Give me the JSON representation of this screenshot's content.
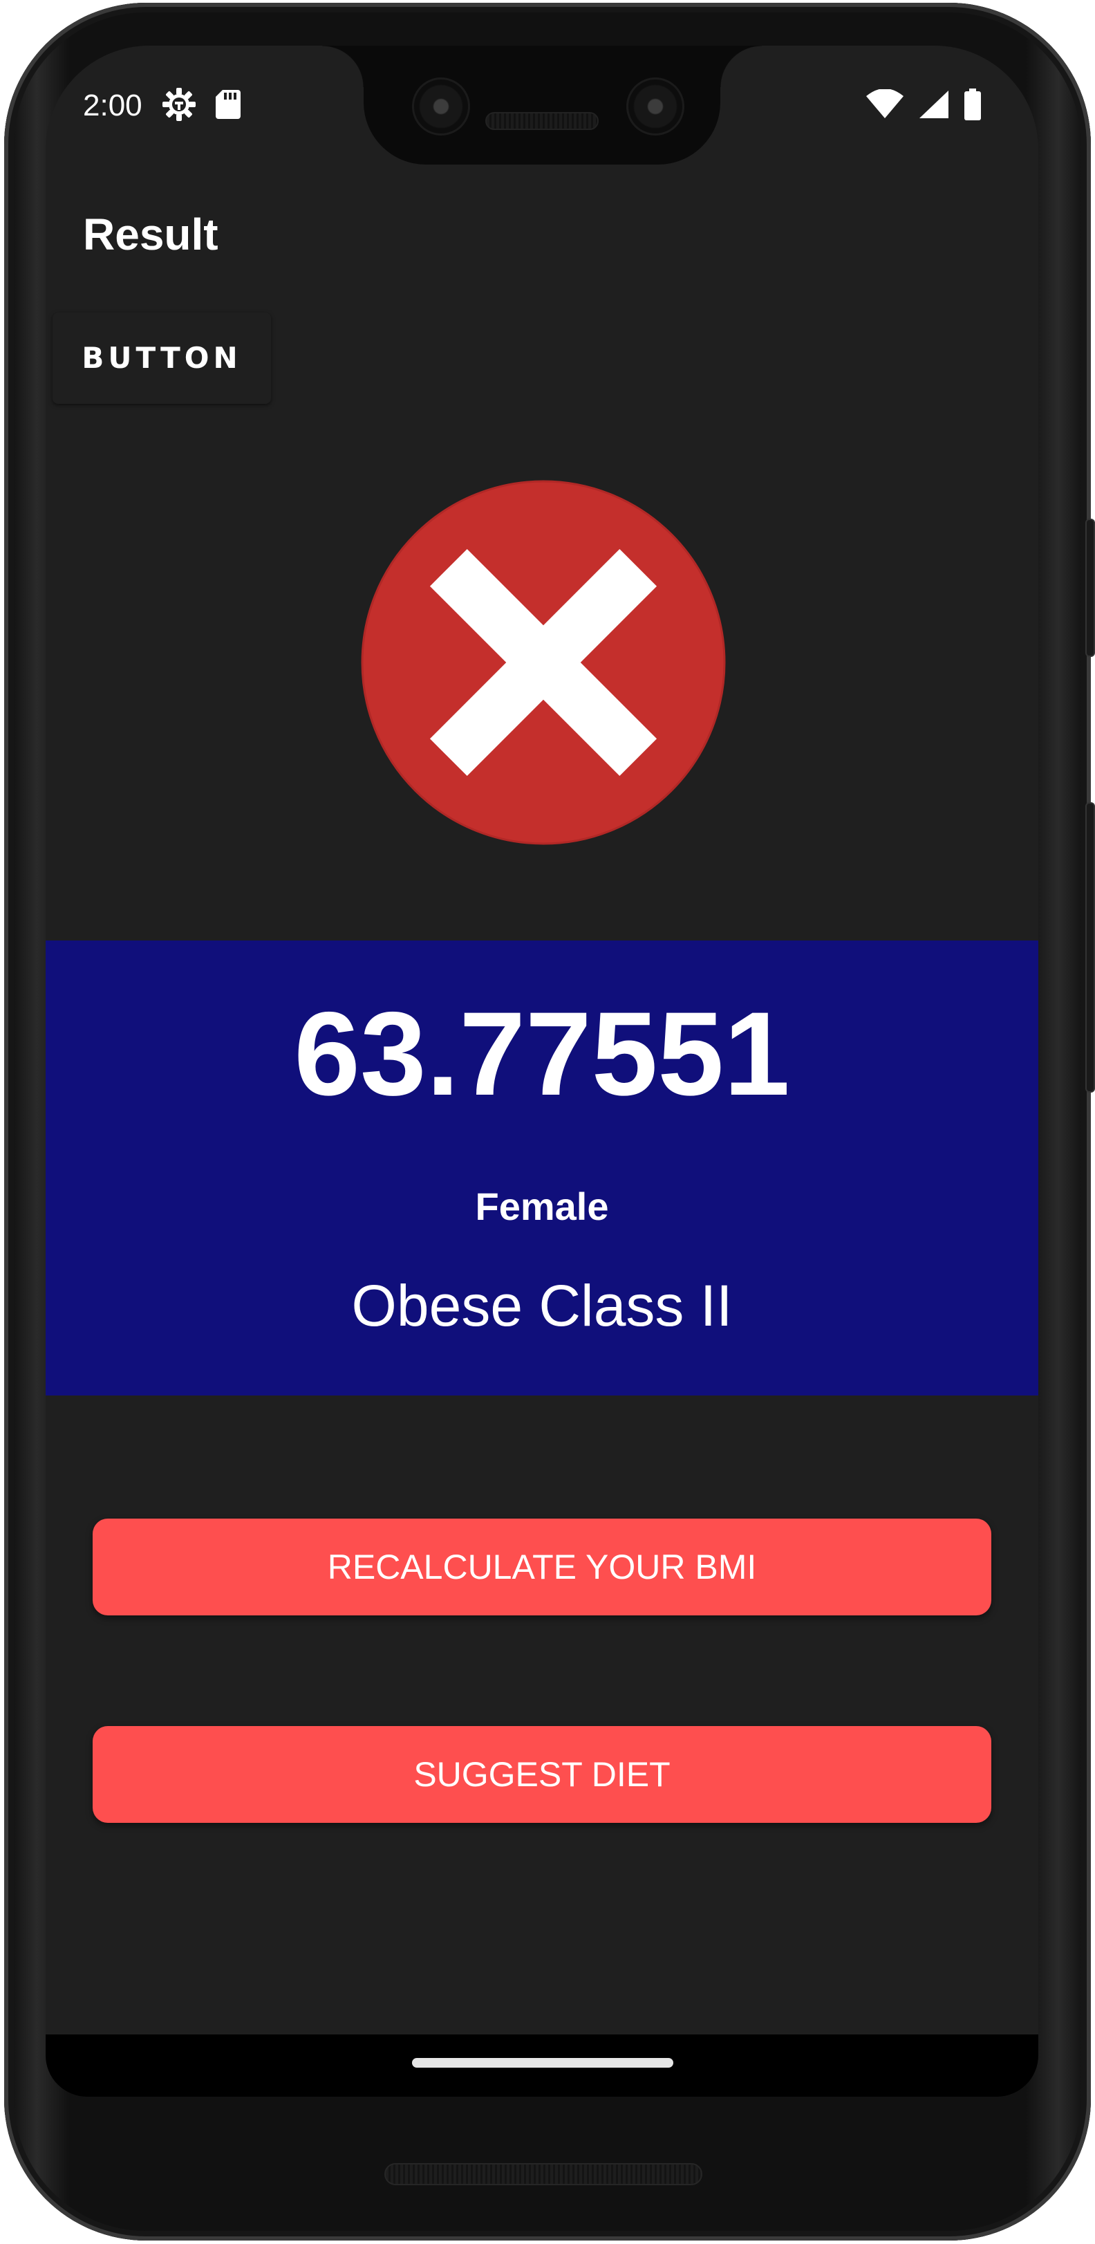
{
  "status_bar": {
    "time": "2:00",
    "left_icons": [
      "settings-gear-icon",
      "sd-card-icon"
    ],
    "right_icons": [
      "wifi-icon",
      "cellular-signal-icon",
      "battery-icon"
    ]
  },
  "header": {
    "title": "Result"
  },
  "top_button": {
    "label": "BUTTON"
  },
  "result": {
    "status_icon": "error-x-icon",
    "status_icon_color": "#c42f2c",
    "bmi": "63.77551",
    "gender": "Female",
    "category": "Obese Class II",
    "panel_color": "#100f7b"
  },
  "actions": {
    "recalculate_label": "RECALCULATE YOUR BMI",
    "suggest_diet_label": "SUGGEST DIET",
    "button_color": "#fe4f4f"
  },
  "navigation": {
    "home_indicator": "home-gesture-bar"
  }
}
